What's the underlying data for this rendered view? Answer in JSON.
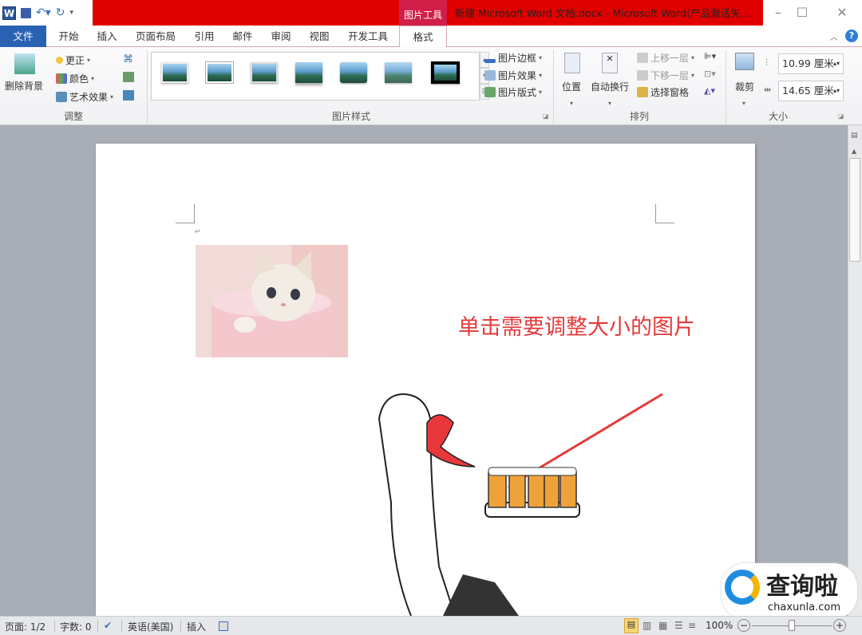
{
  "titlebar": {
    "picture_tools": "图片工具",
    "title": "新建 Microsoft Word 文档.docx - Microsoft Word(产品激活失...",
    "app_icon": "W"
  },
  "tabs": [
    "文件",
    "开始",
    "插入",
    "页面布局",
    "引用",
    "邮件",
    "审阅",
    "视图",
    "开发工具",
    "格式"
  ],
  "ribbon": {
    "adjust": {
      "label": "调整",
      "remove_bg": "删除背景",
      "corrections": "更正",
      "color": "颜色",
      "artistic": "艺术效果"
    },
    "styles": {
      "label": "图片样式",
      "border": "图片边框",
      "effects": "图片效果",
      "layout": "图片版式"
    },
    "arrange": {
      "label": "排列",
      "position": "位置",
      "wrap": "自动换行",
      "forward": "上移一层",
      "backward": "下移一层",
      "selection_pane": "选择窗格"
    },
    "size": {
      "label": "大小",
      "crop": "裁剪",
      "height": "10.99 厘米",
      "width": "14.65 厘米"
    }
  },
  "document": {
    "annotation": "单击需要调整大小的图片",
    "para_mark": "↵"
  },
  "status": {
    "page": "页面: 1/2",
    "words": "字数: 0",
    "language": "英语(美国)",
    "mode": "插入",
    "zoom": "100%"
  },
  "watermark": {
    "brand": "查询啦",
    "url": "chaxunla.com"
  },
  "colors": {
    "title_red": "#e10000",
    "file_tab": "#2a62b3",
    "annotation": "#e33b3b"
  }
}
